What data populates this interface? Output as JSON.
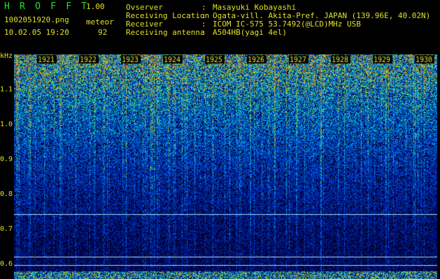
{
  "header": {
    "app_name": "H R O F F T",
    "version": "1.00",
    "filename": "1002051920.png",
    "observation_type": "meteor",
    "datetime": "10.02.05 19:20",
    "count": "92",
    "info": [
      {
        "label": "Ovserver",
        "value": "Masayuki Kobayashi"
      },
      {
        "label": "Receiving Location",
        "value": "Ogata-vill. Akita-Pref. JAPAN (139.96E, 40.02N)"
      },
      {
        "label": "Receiver",
        "value": "ICOM IC-575 53.7492(@LCD)MHz USB"
      },
      {
        "label": "Receiving antenna",
        "value": "A504HB(yagi 4el)"
      }
    ]
  },
  "y_axis": {
    "unit": "kHz",
    "ticks": [
      "1.1",
      "1.0",
      "0.9",
      "0.8",
      "0.7",
      "0.6"
    ]
  },
  "x_axis": {
    "ticks": [
      "1921",
      "1922",
      "1923",
      "1924",
      "1925",
      "1926",
      "1927",
      "1928",
      "1929",
      "1930"
    ]
  },
  "colors": {
    "background": "#000000",
    "text": "#e0e028",
    "title": "#28e028",
    "noise_low": "#0018a0",
    "noise_mid": "#1f9fdf",
    "noise_high": "#e0e028",
    "reference_line": "#9fe0ff"
  }
}
